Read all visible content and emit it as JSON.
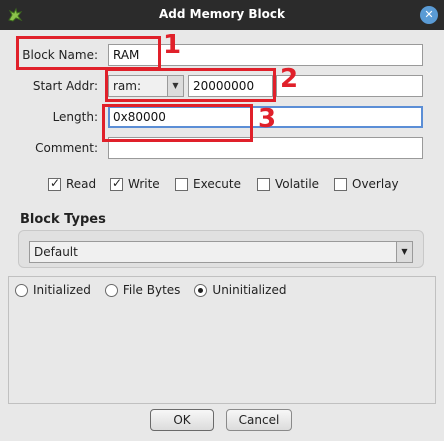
{
  "window": {
    "title": "Add Memory Block",
    "app_icon": "dragon-icon",
    "close_icon": "close-icon"
  },
  "form": {
    "block_name": {
      "label": "Block Name:",
      "value": "RAM"
    },
    "start_addr": {
      "label": "Start Addr:",
      "space": "ram:",
      "value": "20000000"
    },
    "length": {
      "label": "Length:",
      "value": "0x80000"
    },
    "comment": {
      "label": "Comment:",
      "value": ""
    }
  },
  "permissions": [
    {
      "label": "Read",
      "checked": true
    },
    {
      "label": "Write",
      "checked": true
    },
    {
      "label": "Execute",
      "checked": false
    },
    {
      "label": "Volatile",
      "checked": false
    },
    {
      "label": "Overlay",
      "checked": false
    }
  ],
  "block_types": {
    "title": "Block Types",
    "selected": "Default"
  },
  "init_options": [
    {
      "label": "Initialized",
      "selected": false
    },
    {
      "label": "File Bytes",
      "selected": false
    },
    {
      "label": "Uninitialized",
      "selected": true
    }
  ],
  "buttons": {
    "ok": "OK",
    "cancel": "Cancel"
  },
  "annotations": [
    {
      "text": "1"
    },
    {
      "text": "2"
    },
    {
      "text": "3"
    }
  ],
  "colors": {
    "annotation": "#e0202a",
    "titlebar": "#2b2b2b",
    "focus": "#5b8ed6"
  }
}
